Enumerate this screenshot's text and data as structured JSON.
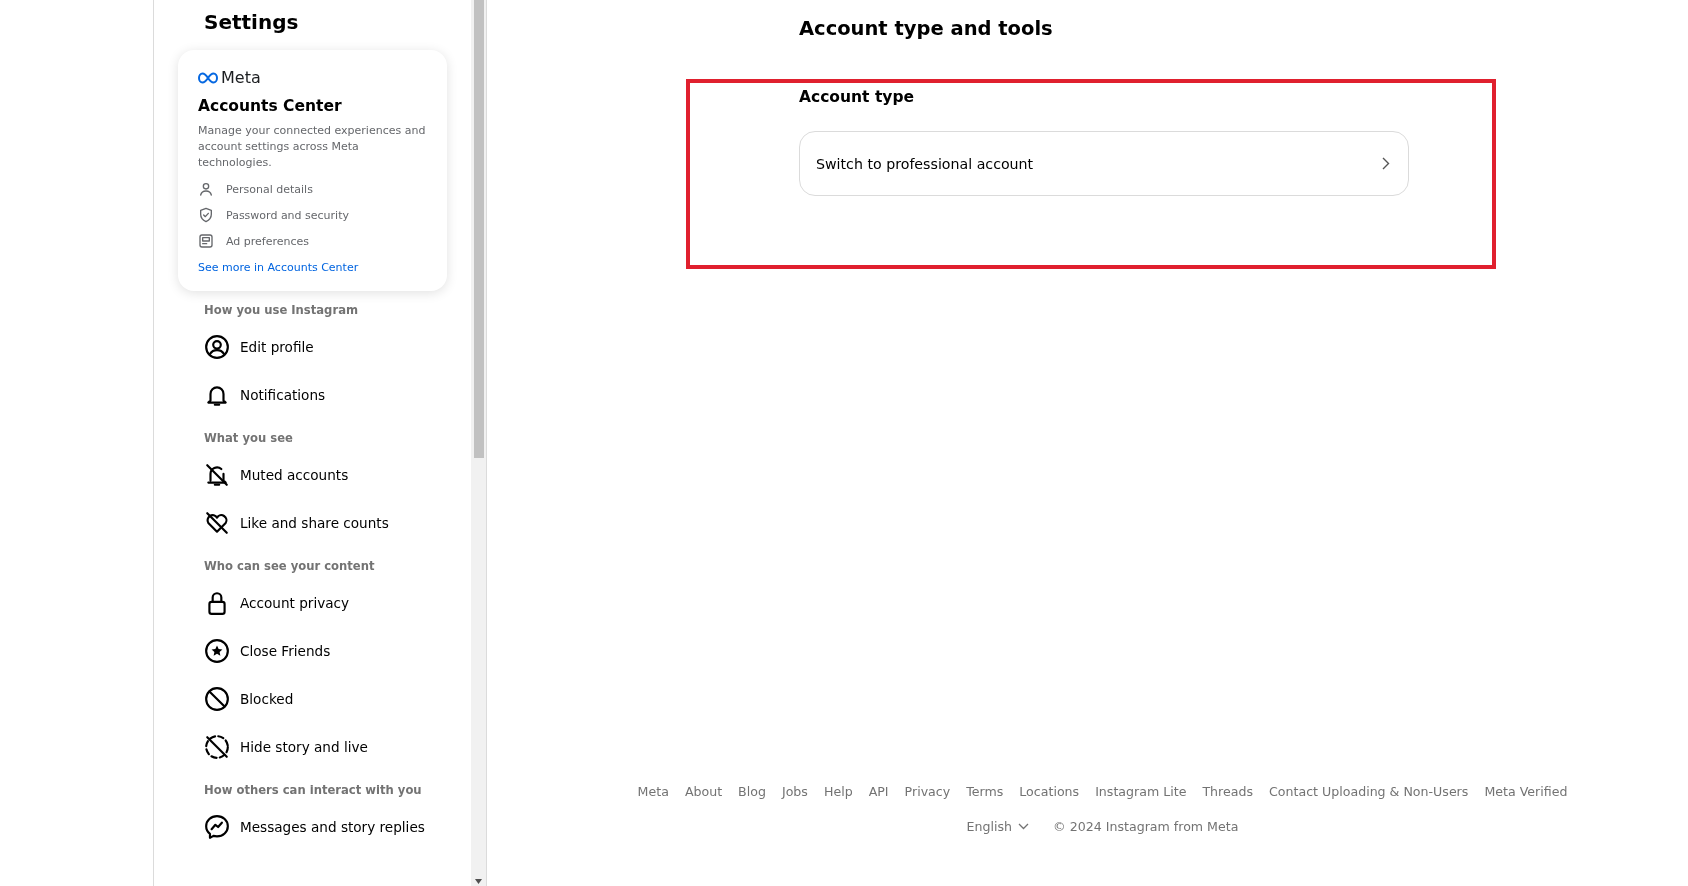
{
  "sidebar": {
    "title": "Settings",
    "accounts_card": {
      "brand": "Meta",
      "title": "Accounts Center",
      "description": "Manage your connected experiences and account settings across Meta technologies.",
      "links": [
        {
          "label": "Personal details"
        },
        {
          "label": "Password and security"
        },
        {
          "label": "Ad preferences"
        }
      ],
      "more_link": "See more in Accounts Center"
    },
    "sections": [
      {
        "heading": "How you use Instagram",
        "items": [
          {
            "label": "Edit profile"
          },
          {
            "label": "Notifications"
          }
        ]
      },
      {
        "heading": "What you see",
        "items": [
          {
            "label": "Muted accounts"
          },
          {
            "label": "Like and share counts"
          }
        ]
      },
      {
        "heading": "Who can see your content",
        "items": [
          {
            "label": "Account privacy"
          },
          {
            "label": "Close Friends"
          },
          {
            "label": "Blocked"
          },
          {
            "label": "Hide story and live"
          }
        ]
      },
      {
        "heading": "How others can interact with you",
        "items": [
          {
            "label": "Messages and story replies"
          }
        ]
      }
    ]
  },
  "main": {
    "title": "Account type and tools",
    "section_title": "Account type",
    "option": "Switch to professional account"
  },
  "footer": {
    "links": [
      "Meta",
      "About",
      "Blog",
      "Jobs",
      "Help",
      "API",
      "Privacy",
      "Terms",
      "Locations",
      "Instagram Lite",
      "Threads",
      "Contact Uploading & Non-Users",
      "Meta Verified"
    ],
    "language": "English",
    "copyright": "© 2024 Instagram from Meta"
  }
}
